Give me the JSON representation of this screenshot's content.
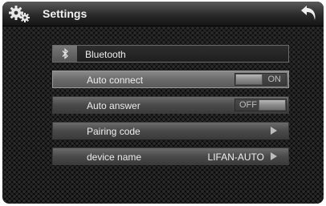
{
  "header": {
    "title": "Settings",
    "left_icon": "settings-gears-icon",
    "right_icon": "back-arrow-icon"
  },
  "bluetooth": {
    "icon": "bluetooth-icon",
    "label": "Bluetooth"
  },
  "auto_connect": {
    "label": "Auto connect",
    "state_text": "ON"
  },
  "auto_answer": {
    "label": "Auto answer",
    "state_text": "OFF"
  },
  "pairing_code": {
    "label": "Pairing code",
    "icon": "chevron-right-icon"
  },
  "device_name": {
    "label": "device name",
    "value": "LIFAN-AUTO",
    "icon": "chevron-right-icon"
  }
}
